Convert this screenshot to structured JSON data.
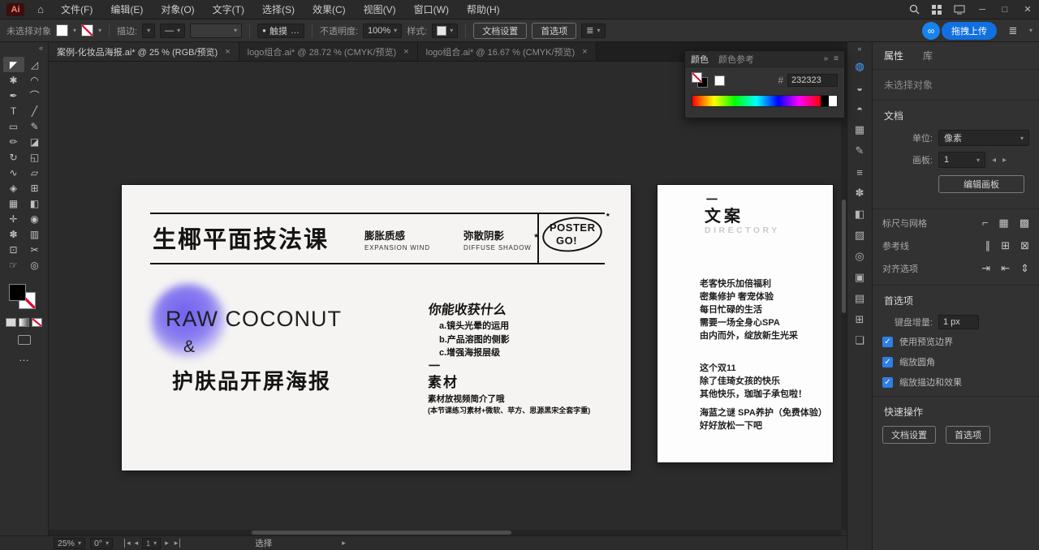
{
  "ui": {
    "close_glyph": "×",
    "chevron_down": "▾",
    "chevron_left": "◂",
    "chevron_right": "▸",
    "collapse_left": "«",
    "collapse_right": "»",
    "menu_glyph": "≡",
    "ellipsis": "…",
    "star": "★",
    "dot": "●",
    "infinity": "∞",
    "list_icon": "≣",
    "check": "✓"
  },
  "menubar": {
    "logo": "Ai",
    "home": "⌂",
    "items": [
      "文件(F)",
      "编辑(E)",
      "对象(O)",
      "文字(T)",
      "选择(S)",
      "效果(C)",
      "视图(V)",
      "窗口(W)",
      "帮助(H)"
    ],
    "minimize": "─",
    "maximize": "□",
    "close": "✕"
  },
  "controlbar": {
    "no_selection": "未选择对象",
    "stroke_label": "描边:",
    "touch": "触摸",
    "opacity_label": "不透明度:",
    "opacity_value": "100%",
    "style_label": "样式:",
    "doc_setup": "文档设置",
    "preferences": "首选项",
    "upload": "拖拽上传"
  },
  "tabs": [
    {
      "title": "案例-化妆品海报.ai* @ 25 % (RGB/预览)"
    },
    {
      "title": "logo组合.ai* @ 28.72 % (CMYK/预览)"
    },
    {
      "title": "logo组合.ai* @ 16.67 % (CMYK/预览)"
    }
  ],
  "toolbar": {
    "tools": [
      {
        "name": "selection",
        "glyph": "◤"
      },
      {
        "name": "direct-selection",
        "glyph": "◿"
      },
      {
        "name": "magic-wand",
        "glyph": "✱"
      },
      {
        "name": "lasso",
        "glyph": "◠"
      },
      {
        "name": "pen",
        "glyph": "✒"
      },
      {
        "name": "curvature",
        "glyph": "⌒"
      },
      {
        "name": "type",
        "glyph": "T"
      },
      {
        "name": "line-segment",
        "glyph": "╱"
      },
      {
        "name": "rectangle",
        "glyph": "▭"
      },
      {
        "name": "paintbrush",
        "glyph": "✎"
      },
      {
        "name": "pencil",
        "glyph": "✏"
      },
      {
        "name": "eraser",
        "glyph": "◪"
      },
      {
        "name": "rotate",
        "glyph": "↻"
      },
      {
        "name": "scale",
        "glyph": "◱"
      },
      {
        "name": "width",
        "glyph": "∿"
      },
      {
        "name": "free-transform",
        "glyph": "▱"
      },
      {
        "name": "shape-builder",
        "glyph": "◈"
      },
      {
        "name": "perspective-grid",
        "glyph": "⊞"
      },
      {
        "name": "mesh",
        "glyph": "▦"
      },
      {
        "name": "gradient",
        "glyph": "◧"
      },
      {
        "name": "eyedropper",
        "glyph": "✛"
      },
      {
        "name": "blend",
        "glyph": "◉"
      },
      {
        "name": "symbol-sprayer",
        "glyph": "✽"
      },
      {
        "name": "column-graph",
        "glyph": "▥"
      },
      {
        "name": "artboard",
        "glyph": "⊡"
      },
      {
        "name": "slice",
        "glyph": "✂"
      },
      {
        "name": "hand",
        "glyph": "☞"
      },
      {
        "name": "zoom",
        "glyph": "◎"
      }
    ]
  },
  "color_panel": {
    "tab_color": "颜色",
    "tab_guide": "颜色参考",
    "hex_label": "#",
    "hex_value": "232323"
  },
  "dock": {
    "icons": [
      {
        "name": "cloud-sync",
        "glyph": "◍"
      },
      {
        "name": "color",
        "glyph": "◒"
      },
      {
        "name": "color-guide",
        "glyph": "◓"
      },
      {
        "name": "swatches",
        "glyph": "▦"
      },
      {
        "name": "brushes",
        "glyph": "✎"
      },
      {
        "name": "stroke",
        "glyph": "≡"
      },
      {
        "name": "symbols",
        "glyph": "✽"
      },
      {
        "name": "gradient",
        "glyph": "◧"
      },
      {
        "name": "transparency",
        "glyph": "▨"
      },
      {
        "name": "appearance",
        "glyph": "◎"
      },
      {
        "name": "graphic-styles",
        "glyph": "▣"
      },
      {
        "name": "layers",
        "glyph": "▤"
      },
      {
        "name": "artboards",
        "glyph": "⊞"
      },
      {
        "name": "comments",
        "glyph": "❏"
      }
    ]
  },
  "properties": {
    "tab1": "属性",
    "tab2": "库",
    "no_selection": "未选择对象",
    "sections": {
      "document": "文档",
      "prefs": "首选项",
      "quick": "快速操作"
    },
    "unit_label": "单位:",
    "unit_value": "像素",
    "artboard_label": "画板:",
    "artboard_value": "1",
    "edit_artboard": "编辑画板",
    "ruler_grid_label": "标尺与网格",
    "ruler_icons": [
      "⌐",
      "▦",
      "▩"
    ],
    "guides_label": "参考线",
    "guide_icons": [
      "∥",
      "⊞",
      "⊠"
    ],
    "align_label": "对齐选项",
    "align_icons": [
      "⇥",
      "⇤",
      "⇕"
    ],
    "keyboard_label": "键盘增量:",
    "keyboard_value": "1 px",
    "checks": [
      "使用预览边界",
      "缩放圆角",
      "缩放描边和效果"
    ],
    "doc_setup": "文档设置",
    "preferences": "首选项"
  },
  "statusbar": {
    "zoom": "25%",
    "rotation": "0°",
    "artboard": "1",
    "tool": "选择"
  },
  "poster": {
    "title": "生椰平面技法课",
    "feature1_cn": "膨胀质感",
    "feature1_en": "EXPANSION WIND",
    "feature2_cn": "弥散阴影",
    "feature2_en": "DIFFUSE SHADOW",
    "badge_top": "POSTER",
    "badge_bottom": "GO!",
    "brand": "RAW COCONUT",
    "ampersand": "&",
    "subtitle": "护肤品开屏海报",
    "gain_title": "你能收获什么",
    "gain_items": [
      "a.镜头光晕的运用",
      "b.产品溶图的侧影",
      "c.增强海报层级"
    ],
    "divider": "一",
    "material_title": "素材",
    "material_note1": "素材放视频简介了哦",
    "material_note2": "(本节课练习素材+微软、苹方、思源黑宋全套字重)"
  },
  "copydoc": {
    "divider": "一",
    "title": "文案",
    "subtitle": "DIRECTORY",
    "para1": [
      "老客快乐加倍福利",
      "密集修护 奢宠体验",
      "每日忙碌的生活",
      "需要一场全身心SPA",
      "由内而外，绽放新生光采"
    ],
    "para2": [
      "这个双11",
      "除了佳琦女孩的快乐",
      "其他快乐，珈珈子承包啦！"
    ],
    "para3": [
      "海蓝之谜 SPA养护（免费体验）",
      "好好放松一下吧"
    ]
  }
}
